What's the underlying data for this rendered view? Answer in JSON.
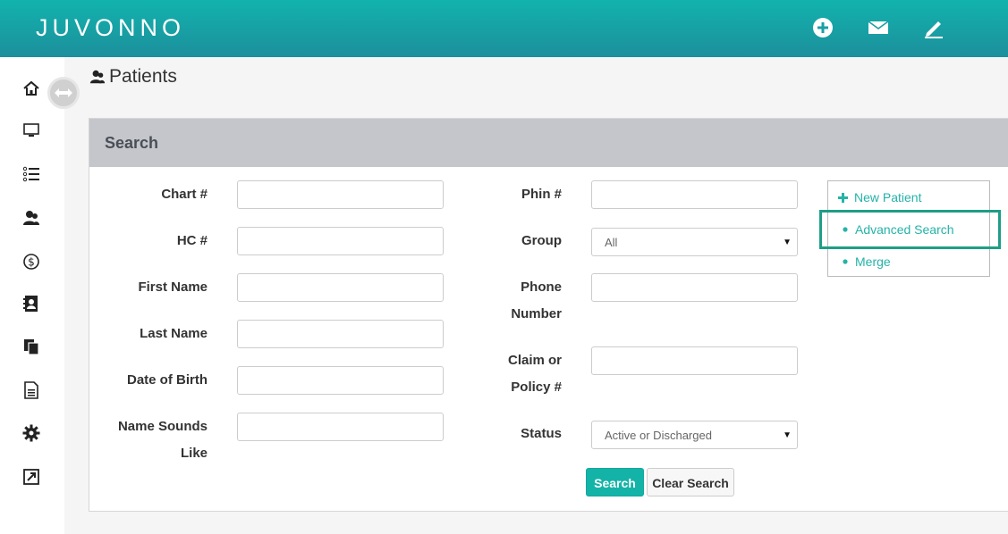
{
  "header": {
    "logo": "JUVONNO",
    "icons": [
      "plus-circle-icon",
      "envelope-icon",
      "pencil-icon"
    ]
  },
  "sidebar": {
    "items": [
      "home-icon",
      "monitor-icon",
      "list-icon",
      "patients-icon",
      "dollar-icon",
      "contacts-icon",
      "documents-icon",
      "file-icon",
      "gear-icon",
      "external-link-icon"
    ]
  },
  "page": {
    "title": "Patients"
  },
  "search": {
    "title": "Search",
    "left": {
      "chart": "Chart #",
      "hc": "HC #",
      "first_name": "First Name",
      "last_name": "Last Name",
      "dob": "Date of Birth",
      "sounds_like_1": "Name Sounds",
      "sounds_like_2": "Like"
    },
    "right": {
      "phin": "Phin #",
      "group": "Group",
      "group_value": "All",
      "phone_1": "Phone",
      "phone_2": "Number",
      "claim_1": "Claim or",
      "claim_2": "Policy #",
      "status": "Status",
      "status_value": "Active or Discharged"
    },
    "buttons": {
      "search": "Search",
      "clear": "Clear Search"
    }
  },
  "actions": {
    "new_patient": "New Patient",
    "advanced_search": "Advanced Search",
    "merge": "Merge"
  },
  "colors": {
    "accent": "#14b3a8",
    "header_top": "#12b3ad",
    "header_bottom": "#1c8f9c",
    "highlight": "#1e9e86"
  }
}
